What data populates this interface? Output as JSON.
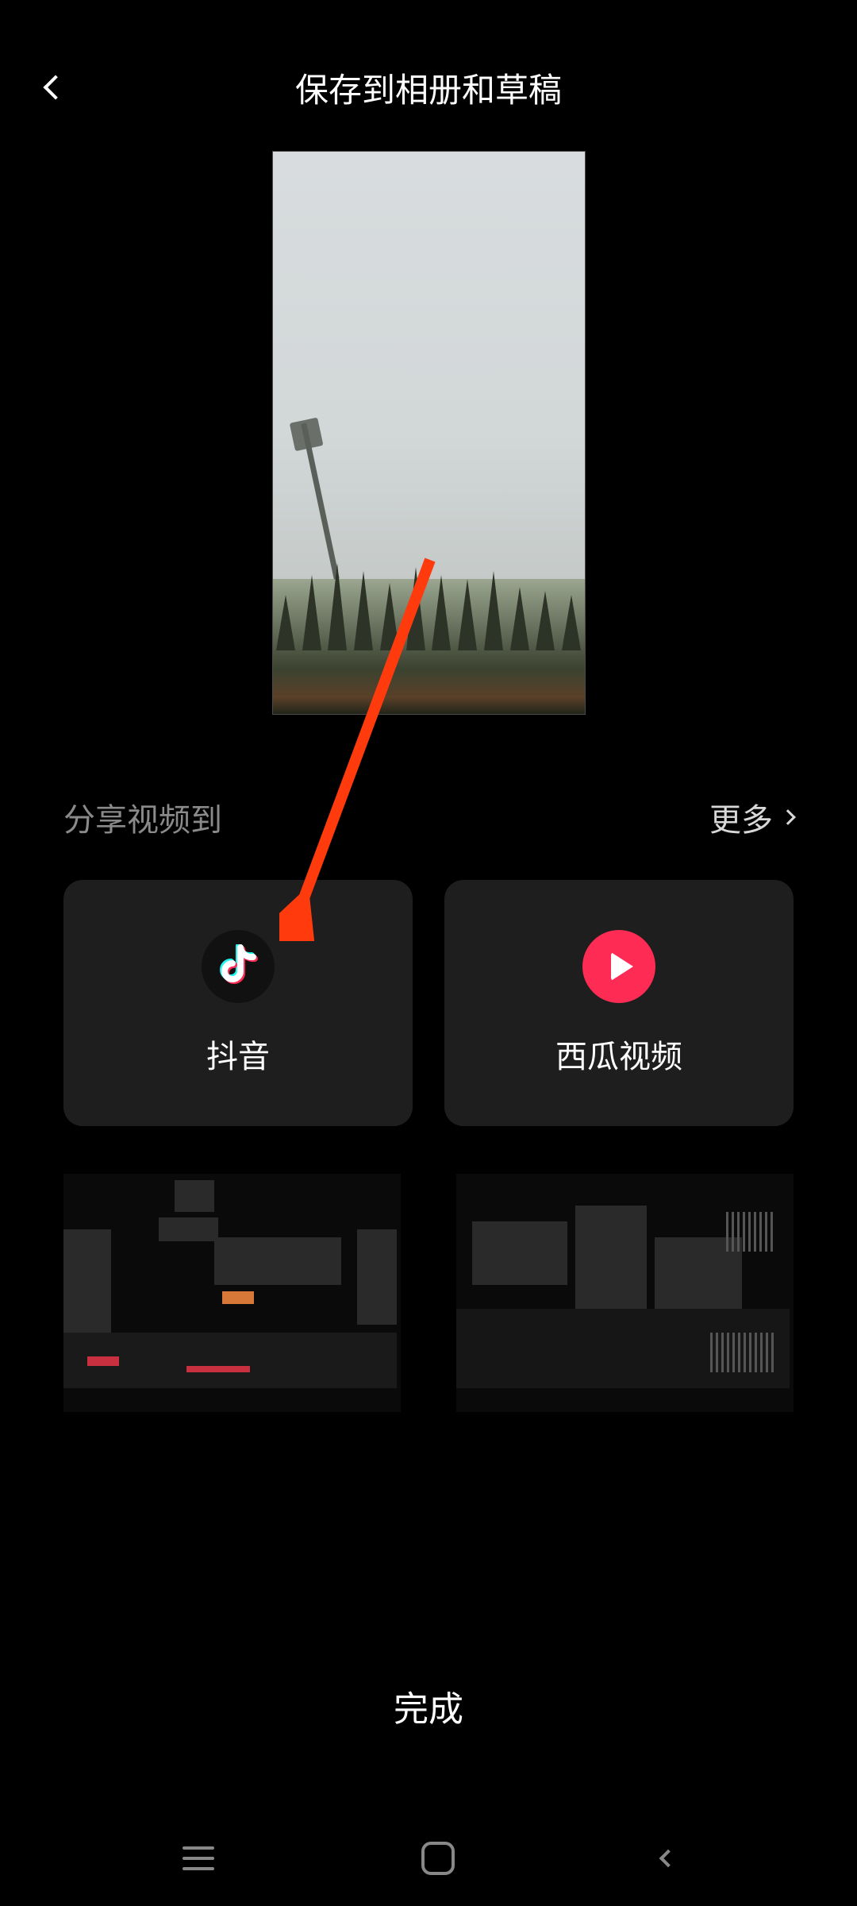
{
  "header": {
    "title": "保存到相册和草稿"
  },
  "share": {
    "label": "分享视频到",
    "more_label": "更多",
    "options": [
      {
        "name": "douyin",
        "label": "抖音"
      },
      {
        "name": "xigua",
        "label": "西瓜视频"
      }
    ]
  },
  "footer": {
    "done_label": "完成"
  },
  "annotation": {
    "arrow_target": "douyin-share-card",
    "arrow_color": "#ff3b0e"
  }
}
